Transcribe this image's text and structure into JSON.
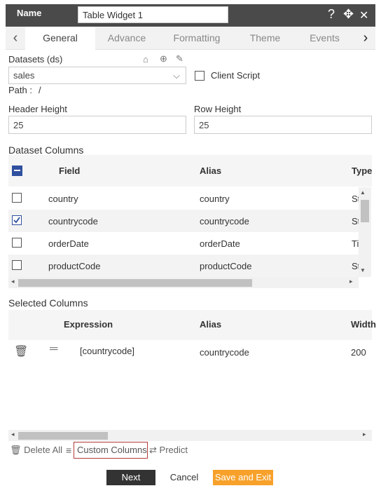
{
  "header": {
    "name_label": "Name",
    "widget_name": "Table Widget 1",
    "help_icon": "?",
    "move_icon": "✥",
    "close_icon": "✕"
  },
  "tabs": {
    "prev": "‹",
    "next": "›",
    "items": [
      "General",
      "Advance",
      "Formatting",
      "Theme",
      "Events"
    ],
    "active": "General"
  },
  "datasets": {
    "label": "Datasets (ds)",
    "value": "sales",
    "client_script_label": "Client Script",
    "client_script_checked": false,
    "path_label": "Path :",
    "path_value": "/"
  },
  "header_height": {
    "label": "Header Height",
    "value": "25"
  },
  "row_height": {
    "label": "Row Height",
    "value": "25"
  },
  "dataset_columns": {
    "title": "Dataset Columns",
    "headers": {
      "field": "Field",
      "alias": "Alias",
      "type": "Type"
    },
    "rows": [
      {
        "field": "country",
        "alias": "country",
        "type": "St",
        "checked": false
      },
      {
        "field": "countrycode",
        "alias": "countrycode",
        "type": "St",
        "checked": true
      },
      {
        "field": "orderDate",
        "alias": "orderDate",
        "type": "Ti",
        "checked": false
      },
      {
        "field": "productCode",
        "alias": "productCode",
        "type": "St",
        "checked": false
      }
    ]
  },
  "selected_columns": {
    "title": "Selected Columns",
    "headers": {
      "expression": "Expression",
      "alias": "Alias",
      "width": "Width"
    },
    "rows": [
      {
        "expression": "[countrycode]",
        "alias": "countrycode",
        "width": "200"
      }
    ]
  },
  "actions": {
    "delete_all": "Delete All",
    "custom_columns": "Custom Columns",
    "predict": "Predict"
  },
  "footer": {
    "next": "Next",
    "cancel": "Cancel",
    "save_exit": "Save and Exit"
  },
  "colors": {
    "header_bg": "#4a4a4a",
    "accent_blue": "#2f4f9f",
    "save_orange": "#f7a12a",
    "next_dark": "#333333"
  }
}
